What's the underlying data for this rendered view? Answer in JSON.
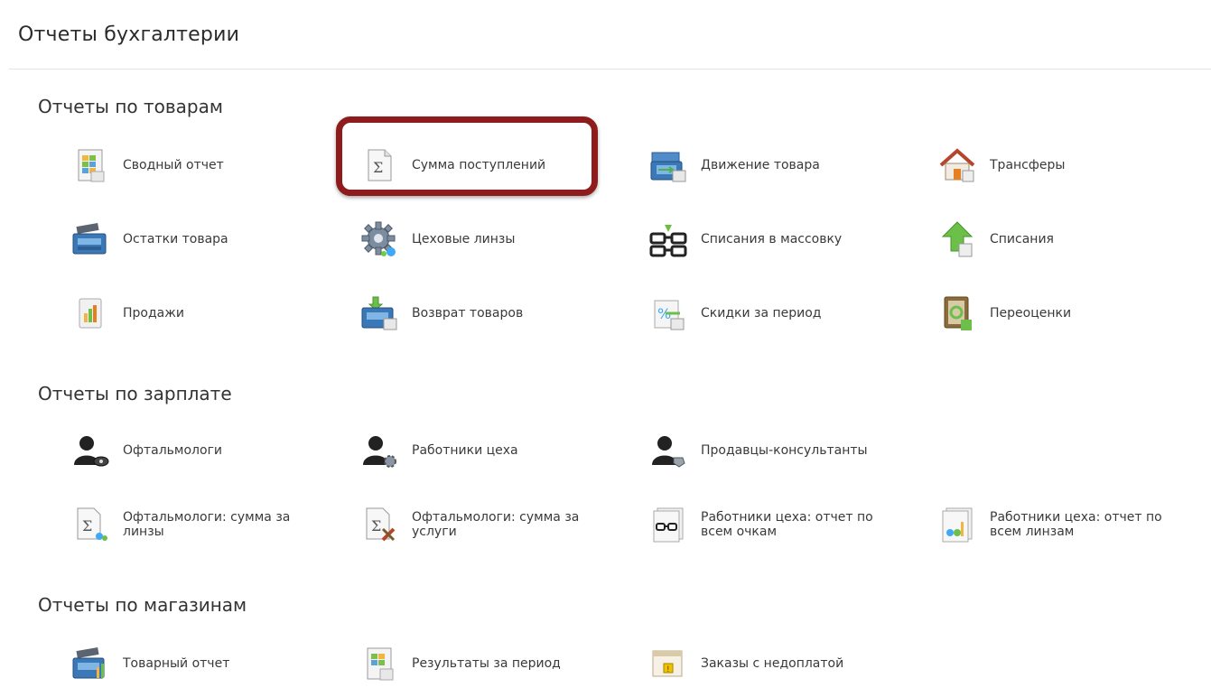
{
  "page_title": "Отчеты бухгалтерии",
  "sections": {
    "goods": {
      "title": "Отчеты по товарам",
      "items": [
        {
          "label": "Сводный отчет",
          "icon": "spreadsheet-report-icon"
        },
        {
          "label": "Сумма поступлений",
          "icon": "sigma-document-icon"
        },
        {
          "label": "Движение товара",
          "icon": "cash-register-transfer-icon"
        },
        {
          "label": "Трансферы",
          "icon": "house-icon"
        },
        {
          "label": "Остатки товара",
          "icon": "cash-register-icon"
        },
        {
          "label": "Цеховые линзы",
          "icon": "gear-icon"
        },
        {
          "label": "Списания в массовку",
          "icon": "glasses-icon"
        },
        {
          "label": "Списания",
          "icon": "up-arrow-document-icon"
        },
        {
          "label": "Продажи",
          "icon": "bar-chart-document-icon"
        },
        {
          "label": "Возврат товаров",
          "icon": "cash-register-return-icon"
        },
        {
          "label": "Скидки за период",
          "icon": "percent-calendar-icon"
        },
        {
          "label": "Переоценки",
          "icon": "book-refresh-icon"
        }
      ]
    },
    "salary": {
      "title": "Отчеты по зарплате",
      "items": [
        {
          "label": "Офтальмологи",
          "icon": "user-eye-icon"
        },
        {
          "label": "Работники цеха",
          "icon": "user-gear-icon"
        },
        {
          "label": "Продавцы-консультанты",
          "icon": "user-tag-icon"
        },
        {
          "label": "Офтальмологи: сумма за линзы",
          "icon": "sigma-lens-icon"
        },
        {
          "label": "Офтальмологи: сумма за услуги",
          "icon": "sigma-tools-icon"
        },
        {
          "label": "Работники цеха: отчет по всем очкам",
          "icon": "glasses-documents-icon"
        },
        {
          "label": "Работники цеха: отчет по всем линзам",
          "icon": "lens-documents-icon"
        }
      ]
    },
    "shops": {
      "title": "Отчеты по магазинам",
      "items": [
        {
          "label": "Товарный отчет",
          "icon": "cash-register-chart-icon"
        },
        {
          "label": "Результаты за период",
          "icon": "spreadsheet-calendar-icon"
        },
        {
          "label": "Заказы с недоплатой",
          "icon": "window-warning-icon"
        }
      ]
    }
  },
  "colors": {
    "highlight_border": "#8e1c1c",
    "text": "#3a3a3a",
    "heading": "#333333"
  }
}
